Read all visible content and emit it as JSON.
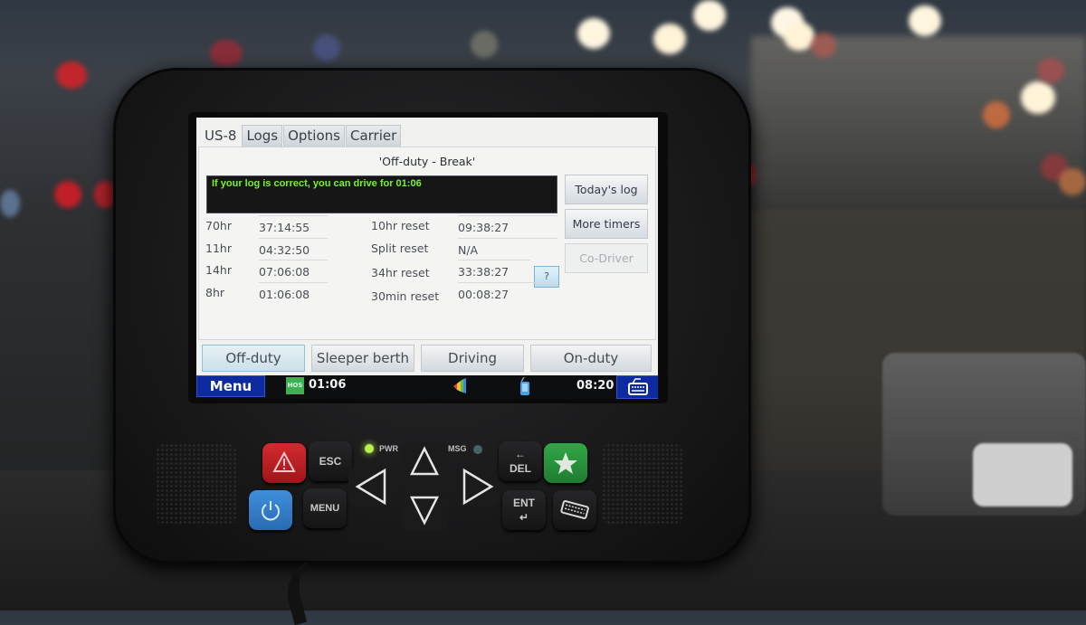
{
  "screen": {
    "tabs": [
      {
        "label": "US-8",
        "active": true
      },
      {
        "label": "Logs",
        "active": false
      },
      {
        "label": "Options",
        "active": false
      },
      {
        "label": "Carrier",
        "active": false
      }
    ],
    "duty_status_title": "'Off-duty - Break'",
    "message": "If your log is correct, you can drive for 01:06",
    "side_buttons": [
      {
        "label": "Today's log",
        "enabled": true
      },
      {
        "label": "More timers",
        "enabled": true
      },
      {
        "label": "Co-Driver",
        "enabled": false
      }
    ],
    "timers_left": [
      {
        "label": "70hr",
        "value": "37:14:55"
      },
      {
        "label": "11hr",
        "value": "04:32:50"
      },
      {
        "label": "14hr",
        "value": "07:06:08"
      },
      {
        "label": "8hr",
        "value": "01:06:08"
      }
    ],
    "timers_right": [
      {
        "label": "10hr reset",
        "value": "09:38:27"
      },
      {
        "label": "Split reset",
        "value": "N/A"
      },
      {
        "label": "34hr reset",
        "value": "33:38:27"
      },
      {
        "label": "30min reset",
        "value": "00:08:27"
      }
    ],
    "help_button_label": "?",
    "duty_buttons": [
      {
        "label": "Off-duty",
        "active": true
      },
      {
        "label": "Sleeper berth",
        "active": false
      },
      {
        "label": "Driving",
        "active": false
      },
      {
        "label": "On-duty",
        "active": false
      }
    ],
    "taskbar": {
      "menu_label": "Menu",
      "hos_badge": "HOS",
      "hos_time": "01:06",
      "clock": "08:20"
    },
    "colors": {
      "message_text": "#79f129",
      "taskbar_blue": "#0e2aa0",
      "hos_green": "#3fae55"
    }
  },
  "keypad": {
    "esc_label": "ESC",
    "menu_label": "MENU",
    "del_label": "DEL",
    "ent_label": "ENT",
    "pwr_label": "PWR",
    "msg_label": "MSG",
    "pwr_led_on": true,
    "msg_led_on": false
  }
}
